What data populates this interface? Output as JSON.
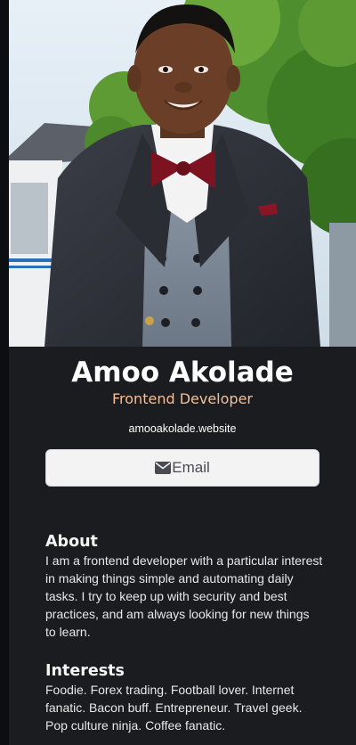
{
  "profile": {
    "name": "Amoo Akolade",
    "role": "Frontend Developer",
    "website": "amooakolade.website"
  },
  "actions": {
    "email_label": "Email",
    "email_icon": "envelope-icon"
  },
  "about": {
    "title": "About",
    "text": "I am a frontend developer with a particular interest in making things simple and automating daily tasks. I try to keep up with security and best practices, and am always looking for new things to learn."
  },
  "interests": {
    "title": "Interests",
    "text": "Foodie. Forex trading. Football lover. Internet fanatic. Bacon buff. Entrepreneur. Travel geek. Pop culture ninja. Coffee fanatic."
  },
  "colors": {
    "card_background": "#1b1c20",
    "page_background": "#0d0e11",
    "accent": "#f3bf99",
    "button_background": "#f3f3f4"
  }
}
